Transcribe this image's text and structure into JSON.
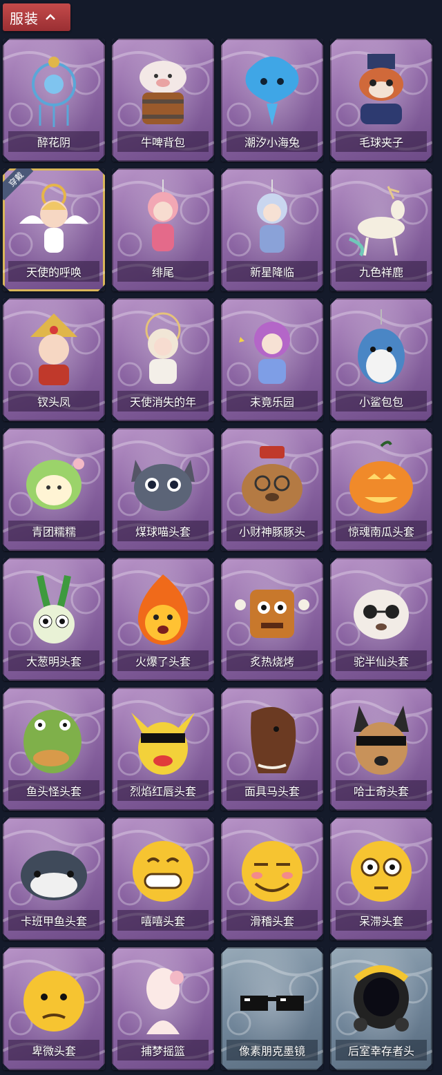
{
  "header": {
    "label": "服装",
    "icon": "chevron-up-icon",
    "color": "#b63c3f"
  },
  "equipped_badge": "穿戴",
  "items": [
    {
      "name": "醉花阴",
      "bg": "purple",
      "art": "ornament"
    },
    {
      "name": "牛啤背包",
      "bg": "purple",
      "art": "barrel"
    },
    {
      "name": "潮汐小海兔",
      "bg": "purple",
      "art": "seabunny"
    },
    {
      "name": "毛球夹子",
      "bg": "purple",
      "art": "fox"
    },
    {
      "name": "天使的呼唤",
      "bg": "purple",
      "art": "angel",
      "equipped": true
    },
    {
      "name": "绯尾",
      "bg": "purple",
      "art": "doll-pink"
    },
    {
      "name": "新星降临",
      "bg": "purple",
      "art": "doll-blue"
    },
    {
      "name": "九色祥鹿",
      "bg": "purple",
      "art": "deer"
    },
    {
      "name": "钗头凤",
      "bg": "purple",
      "art": "phoenix"
    },
    {
      "name": "天使消失的年",
      "bg": "purple",
      "art": "doll-white"
    },
    {
      "name": "未竟乐园",
      "bg": "purple",
      "art": "doll-purple"
    },
    {
      "name": "小鲨包包",
      "bg": "purple",
      "art": "shark"
    },
    {
      "name": "青团糯糯",
      "bg": "purple",
      "art": "mochi"
    },
    {
      "name": "煤球喵头套",
      "bg": "purple",
      "art": "cat"
    },
    {
      "name": "小财神豚豚头",
      "bg": "purple",
      "art": "capybara"
    },
    {
      "name": "惊魂南瓜头套",
      "bg": "purple",
      "art": "pumpkin"
    },
    {
      "name": "大葱明头套",
      "bg": "purple",
      "art": "scallion"
    },
    {
      "name": "火爆了头套",
      "bg": "purple",
      "art": "flame"
    },
    {
      "name": "炙热烧烤",
      "bg": "purple",
      "art": "meat"
    },
    {
      "name": "驼半仙头套",
      "bg": "purple",
      "art": "alpaca"
    },
    {
      "name": "鱼头怪头套",
      "bg": "purple",
      "art": "fishhead"
    },
    {
      "name": "烈焰红唇头套",
      "bg": "purple",
      "art": "pika"
    },
    {
      "name": "面具马头套",
      "bg": "purple",
      "art": "horse"
    },
    {
      "name": "哈士奇头套",
      "bg": "purple",
      "art": "husky"
    },
    {
      "name": "卡班甲鱼头套",
      "bg": "purple",
      "art": "whale"
    },
    {
      "name": "嘻嘻头套",
      "bg": "purple",
      "art": "emoji-grin"
    },
    {
      "name": "滑稽头套",
      "bg": "purple",
      "art": "emoji-smirk"
    },
    {
      "name": "呆滞头套",
      "bg": "purple",
      "art": "emoji-stare"
    },
    {
      "name": "卑微头套",
      "bg": "purple",
      "art": "emoji-meek"
    },
    {
      "name": "捕梦摇篮",
      "bg": "purple",
      "art": "mannequin"
    },
    {
      "name": "像素朋克墨镜",
      "bg": "blue",
      "art": "glasses"
    },
    {
      "name": "后室幸存者头",
      "bg": "blue",
      "art": "helmet"
    }
  ]
}
